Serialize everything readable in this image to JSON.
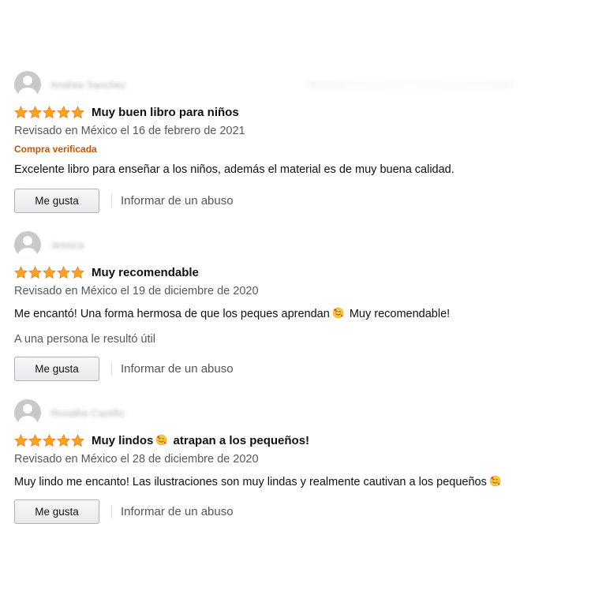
{
  "colors": {
    "star": "#ffa41c",
    "verified": "#c45500",
    "meta": "#565959"
  },
  "reviews": [
    {
      "reviewer_name": "Andrea Sanchez",
      "rating": 5,
      "title": "Muy buen libro para niños",
      "date_text": "Revisado en México el 16 de febrero de 2021",
      "verified": "Compra verificada",
      "body_before": "Excelente libro para enseñar a los niños, además el material es de muy buena calidad.",
      "body_after": "",
      "helpful_text": "",
      "like_button": "Me gusta",
      "report_link": "Informar de un abuso"
    },
    {
      "reviewer_name": "Jessica",
      "rating": 5,
      "title": "Muy recomendable",
      "date_text": "Revisado en México el 19 de diciembre de 2020",
      "verified": "",
      "body_before": "Me encantó! Una forma hermosa de que los peques aprendan",
      "body_after": "Muy recomendable!",
      "helpful_text": "A una persona le resultó útil",
      "like_button": "Me gusta",
      "report_link": "Informar de un abuso"
    },
    {
      "reviewer_name": "Rosalba Castillo",
      "rating": 5,
      "title_before": "Muy lindos",
      "title_after": "atrapan a los pequeños!",
      "date_text": "Revisado en México el 28 de diciembre de 2020",
      "verified": "",
      "body_before": "Muy lindo me encanto! Las ilustraciones son muy lindas y realmente cautivan a los pequeños",
      "body_after": "",
      "helpful_text": "",
      "like_button": "Me gusta",
      "report_link": "Informar de un abuso"
    }
  ],
  "icons": {
    "avatar": "default-user-avatar-icon",
    "star": "star-icon",
    "emoji": "smiling-face-with-hearts-emoji-icon"
  }
}
